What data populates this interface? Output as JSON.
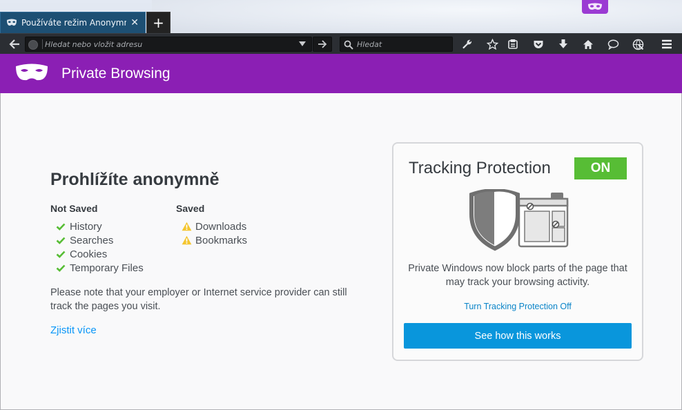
{
  "browser": {
    "tab": {
      "title": "Používáte režim Anonymní…",
      "close_glyph": "✕"
    },
    "new_tab_glyph": "+",
    "url_placeholder": "Hledat nebo vložit adresu",
    "search_placeholder": "Hledat",
    "toolbar_icons": [
      "back-icon",
      "site-identity-icon",
      "dropdown-icon",
      "go-icon",
      "search-icon",
      "wrench-icon",
      "bookmark-star-icon",
      "reading-list-icon",
      "pocket-icon",
      "download-icon",
      "home-icon",
      "chat-icon",
      "globe-icon",
      "menu-icon"
    ],
    "accent_color": "#8b1fb4",
    "tab_color": "#1d4f73",
    "toolbar_color": "#2b2e33"
  },
  "header": {
    "title": "Private Browsing"
  },
  "main": {
    "heading": "Prohlížíte anonymně",
    "not_saved": {
      "title": "Not Saved",
      "items": [
        "History",
        "Searches",
        "Cookies",
        "Temporary Files"
      ]
    },
    "saved": {
      "title": "Saved",
      "items": [
        "Downloads",
        "Bookmarks"
      ]
    },
    "note": "Please note that your employer or Internet service provider can still track the pages you visit.",
    "learn_more": "Zjistit více"
  },
  "tracking": {
    "title": "Tracking Protection",
    "status": "ON",
    "status_color": "#57bd35",
    "description": "Private Windows now block parts of the page that may track your browsing activity.",
    "turn_off": "Turn Tracking Protection Off",
    "button": "See how this works",
    "button_color": "#0996dc"
  }
}
